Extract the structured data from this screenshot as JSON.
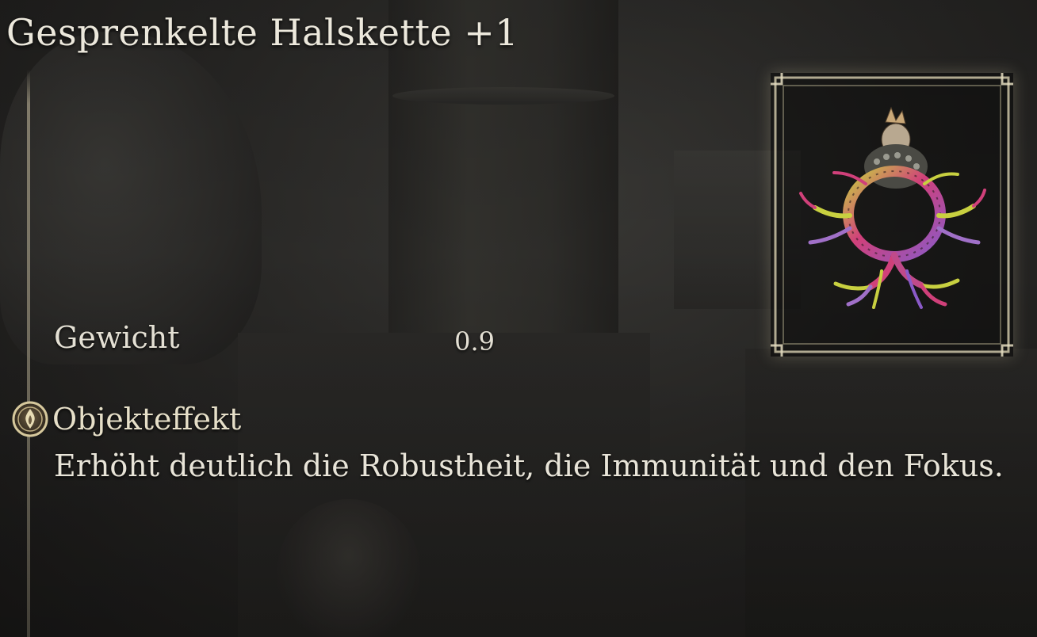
{
  "item": {
    "name": "Gesprenkelte Halskette +1",
    "icon": "speckled-necklace-icon"
  },
  "stats": {
    "weight_label": "Gewicht",
    "weight_value": "0.9"
  },
  "effect": {
    "icon": "item-effect-icon",
    "title": "Objekteffekt",
    "description": "Erhöht deutlich die Robustheit, die Immunität und den Fokus."
  },
  "colors": {
    "text": "#ece8dc",
    "frame": "#d8d0b0",
    "accent": "#c9b98a"
  }
}
